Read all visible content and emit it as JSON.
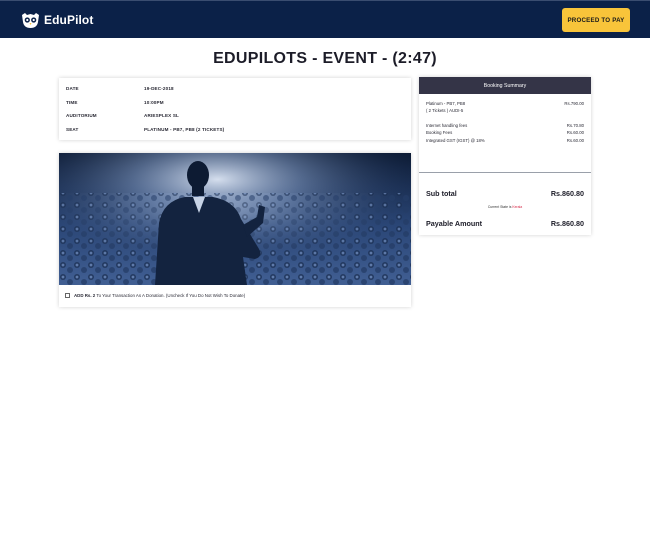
{
  "header": {
    "brand_name": "EduPilot",
    "proceed_label": "PROCEED TO PAY",
    "brand_color": "#0b2148",
    "accent_color": "#f8c43a",
    "logo_icon": "owl-icon"
  },
  "page": {
    "title": "EDUPILOTS - EVENT - (2:47)"
  },
  "event_details": [
    {
      "label": "DATE",
      "value": "19-DEC-2018"
    },
    {
      "label": "TIME",
      "value": "10:00PM"
    },
    {
      "label": "AUDITORIUM",
      "value": "ARIESPLEX SL"
    },
    {
      "label": "SEAT",
      "value": "PLATINUM - PB7, PB8 (2 TICKETS)"
    }
  ],
  "donation": {
    "amount_label": "ADD Rs. 2",
    "text": "To Your Transaction As A Donation. (Uncheck If You Do Not Wish To Donate)",
    "checked": false
  },
  "booking_summary": {
    "title": "Booking Summary",
    "ticket_line": "Platinum - PB7, PB8",
    "ticket_sub": "( 2 Tickets ) AUDI-5",
    "ticket_amount": "Rs.790.00",
    "fees": [
      {
        "label": "Internet handling fees",
        "amount": "Rs.70.80"
      },
      {
        "label": "Booking Fees",
        "amount": "Rs.60.00"
      },
      {
        "label": "Integrated GST (IGST) @ 18%",
        "amount": "Rs.60.00"
      }
    ],
    "subtotal_label": "Sub total",
    "subtotal_amount": "Rs.860.80",
    "state_prefix": "Current State is",
    "state_name": "Kerala",
    "payable_label": "Payable Amount",
    "payable_amount": "Rs.860.80"
  }
}
